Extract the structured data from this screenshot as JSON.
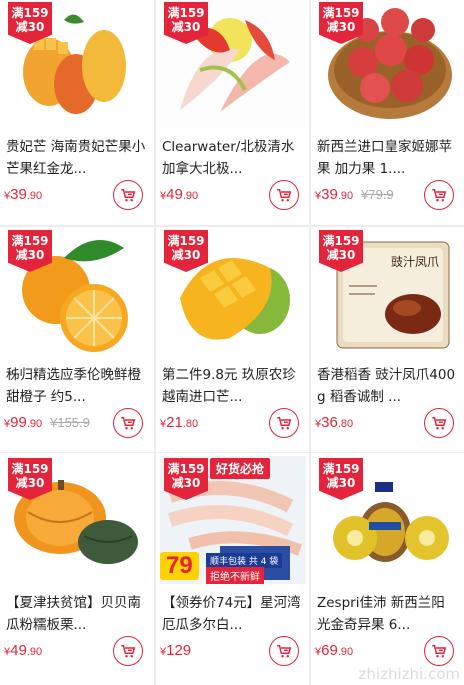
{
  "promo_badge": {
    "line1": "满159",
    "line2": "减30"
  },
  "products": [
    {
      "title": "贵妃芒 海南贵妃芒果小芒果红金龙...",
      "price_yen": "¥",
      "price_int": "39",
      "price_dec": ".90",
      "orig_price": "",
      "image_icon": "mango-icon"
    },
    {
      "title": "Clearwater/北极清水加拿大北极...",
      "price_yen": "¥",
      "price_int": "49",
      "price_dec": ".90",
      "orig_price": "",
      "image_icon": "arctic-clam-icon"
    },
    {
      "title": "新西兰进口皇家姬娜苹果 加力果 1....",
      "price_yen": "¥",
      "price_int": "39",
      "price_dec": ".90",
      "orig_price": "¥79.9",
      "image_icon": "apple-basket-icon"
    },
    {
      "title": "秭归精选应季伦晚鲜橙 甜橙子 约5...",
      "price_yen": "¥",
      "price_int": "99",
      "price_dec": ".90",
      "orig_price": "¥155.9",
      "image_icon": "orange-icon"
    },
    {
      "title": "第二件9.8元 玖原农珍 越南进口芒...",
      "price_yen": "¥",
      "price_int": "21",
      "price_dec": ".80",
      "orig_price": "",
      "image_icon": "mango-cut-icon"
    },
    {
      "title": "香港稻香 豉汁凤爪400g 稻香诚制 ...",
      "price_yen": "¥",
      "price_int": "36",
      "price_dec": ".80",
      "orig_price": "",
      "image_icon": "chicken-feet-box-icon",
      "box_text": "豉汁凤爪"
    },
    {
      "title": "【夏津扶贫馆】贝贝南瓜粉糯板栗...",
      "price_yen": "¥",
      "price_int": "49",
      "price_dec": ".90",
      "orig_price": "",
      "image_icon": "pumpkin-icon"
    },
    {
      "title": "【领券价74元】星河湾厄瓜多尔白...",
      "price_yen": "¥",
      "price_int": "129",
      "price_dec": "",
      "orig_price": "",
      "image_icon": "shrimp-icon",
      "banner": "好货必抢",
      "coupon_price": "79",
      "coupon_tag1": "顺丰包装 共 4 袋",
      "coupon_tag2": "拒绝不新鲜"
    },
    {
      "title": "Zespri佳沛 新西兰阳光金奇异果 6...",
      "price_yen": "¥",
      "price_int": "69",
      "price_dec": ".90",
      "orig_price": "",
      "image_icon": "kiwi-icon"
    }
  ],
  "watermark": "zhizhizhi.com",
  "colors": {
    "accent": "#e3243b",
    "divider": "#ececec",
    "text": "#222222",
    "muted": "#aaaaaa"
  }
}
